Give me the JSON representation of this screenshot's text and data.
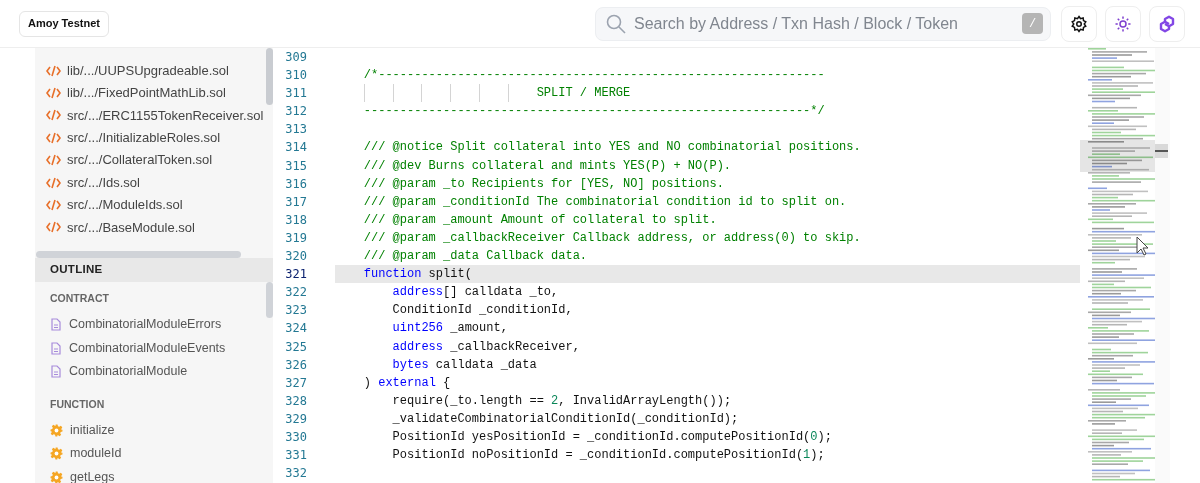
{
  "header": {
    "network_button": "Amoy Testnet",
    "search": {
      "placeholder": "Search by Address / Txn Hash / Block / Token",
      "shortcut": "/"
    }
  },
  "files": [
    {
      "path": "lib/.../UUPSUpgradeable.sol"
    },
    {
      "path": "lib/.../FixedPointMathLib.sol"
    },
    {
      "path": "src/.../ERC1155TokenReceiver.sol"
    },
    {
      "path": "src/.../InitializableRoles.sol"
    },
    {
      "path": "src/.../CollateralToken.sol"
    },
    {
      "path": "src/.../Ids.sol"
    },
    {
      "path": "src/.../ModuleIds.sol"
    },
    {
      "path": "src/.../BaseModule.sol"
    }
  ],
  "outline": {
    "title": "OUTLINE",
    "sections": [
      {
        "title": "CONTRACT",
        "kind": "contract",
        "items": [
          "CombinatorialModuleErrors",
          "CombinatorialModuleEvents",
          "CombinatorialModule"
        ]
      },
      {
        "title": "FUNCTION",
        "kind": "function",
        "items": [
          "initialize",
          "moduleId",
          "getLegs"
        ]
      }
    ]
  },
  "code": {
    "lines": [
      {
        "number": "309",
        "selected": false
      },
      {
        "number": "310",
        "selected": false,
        "tokens": [
          {
            "kind": "comment",
            "text": "    /*--------------------------------------------------------------"
          }
        ]
      },
      {
        "number": "311",
        "selected": false,
        "tokens": [
          {
            "kind": "comment",
            "text": "                            SPLIT / MERGE"
          }
        ]
      },
      {
        "number": "312",
        "selected": false,
        "tokens": [
          {
            "kind": "comment",
            "text": "    --------------------------------------------------------------*/"
          }
        ]
      },
      {
        "number": "313",
        "selected": false
      },
      {
        "number": "314",
        "selected": false,
        "tokens": [
          {
            "kind": "comment",
            "text": "    /// @notice Split collateral into YES and NO combinatorial positions."
          }
        ]
      },
      {
        "number": "315",
        "selected": false,
        "tokens": [
          {
            "kind": "comment",
            "text": "    /// @dev Burns collateral and mints YES(P) + NO(P)."
          }
        ]
      },
      {
        "number": "316",
        "selected": false,
        "tokens": [
          {
            "kind": "comment",
            "text": "    /// @param _to Recipients for [YES, NO] positions."
          }
        ]
      },
      {
        "number": "317",
        "selected": false,
        "tokens": [
          {
            "kind": "comment",
            "text": "    /// @param _conditionId The combinatorial condition id to split on."
          }
        ]
      },
      {
        "number": "318",
        "selected": false,
        "tokens": [
          {
            "kind": "comment",
            "text": "    /// @param _amount Amount of collateral to split."
          }
        ]
      },
      {
        "number": "319",
        "selected": false,
        "tokens": [
          {
            "kind": "comment",
            "text": "    /// @param _callbackReceiver Callback address, or address(0) to skip."
          }
        ]
      },
      {
        "number": "320",
        "selected": false,
        "tokens": [
          {
            "kind": "comment",
            "text": "    /// @param _data Callback data."
          }
        ]
      },
      {
        "number": "321",
        "selected": true,
        "tokens": [
          {
            "kind": "keyword",
            "text": "    function"
          },
          {
            "kind": "plain",
            "text": " split("
          }
        ]
      },
      {
        "number": "322",
        "selected": false,
        "tokens": [
          {
            "kind": "keyword",
            "text": "        address"
          },
          {
            "kind": "plain",
            "text": "[] calldata _to,"
          }
        ]
      },
      {
        "number": "323",
        "selected": false,
        "tokens": [
          {
            "kind": "plain",
            "text": "        ConditionId _conditionId,"
          }
        ]
      },
      {
        "number": "324",
        "selected": false,
        "tokens": [
          {
            "kind": "keyword",
            "text": "        uint256"
          },
          {
            "kind": "plain",
            "text": " _amount,"
          }
        ]
      },
      {
        "number": "325",
        "selected": false,
        "tokens": [
          {
            "kind": "keyword",
            "text": "        address"
          },
          {
            "kind": "plain",
            "text": " _callbackReceiver,"
          }
        ]
      },
      {
        "number": "326",
        "selected": false,
        "tokens": [
          {
            "kind": "keyword",
            "text": "        bytes"
          },
          {
            "kind": "plain",
            "text": " calldata _data"
          }
        ]
      },
      {
        "number": "327",
        "selected": false,
        "tokens": [
          {
            "kind": "plain",
            "text": "    ) "
          },
          {
            "kind": "keyword",
            "text": "external"
          },
          {
            "kind": "plain",
            "text": " {"
          }
        ]
      },
      {
        "number": "328",
        "selected": false,
        "tokens": [
          {
            "kind": "plain",
            "text": "        require(_to.length == "
          },
          {
            "kind": "number",
            "text": "2"
          },
          {
            "kind": "plain",
            "text": ", InvalidArrayLength());"
          }
        ]
      },
      {
        "number": "329",
        "selected": false,
        "tokens": [
          {
            "kind": "plain",
            "text": "        _validateCombinatorialConditionId(_conditionId);"
          }
        ]
      },
      {
        "number": "330",
        "selected": false,
        "tokens": [
          {
            "kind": "plain",
            "text": "        PositionId yesPositionId = _conditionId.computePositionId("
          },
          {
            "kind": "number",
            "text": "0"
          },
          {
            "kind": "plain",
            "text": ");"
          }
        ]
      },
      {
        "number": "331",
        "selected": false,
        "tokens": [
          {
            "kind": "plain",
            "text": "        PositionId noPositionId = _conditionId.computePositionId("
          },
          {
            "kind": "number",
            "text": "1"
          },
          {
            "kind": "plain",
            "text": ");"
          }
        ]
      },
      {
        "number": "332",
        "selected": false
      }
    ]
  }
}
